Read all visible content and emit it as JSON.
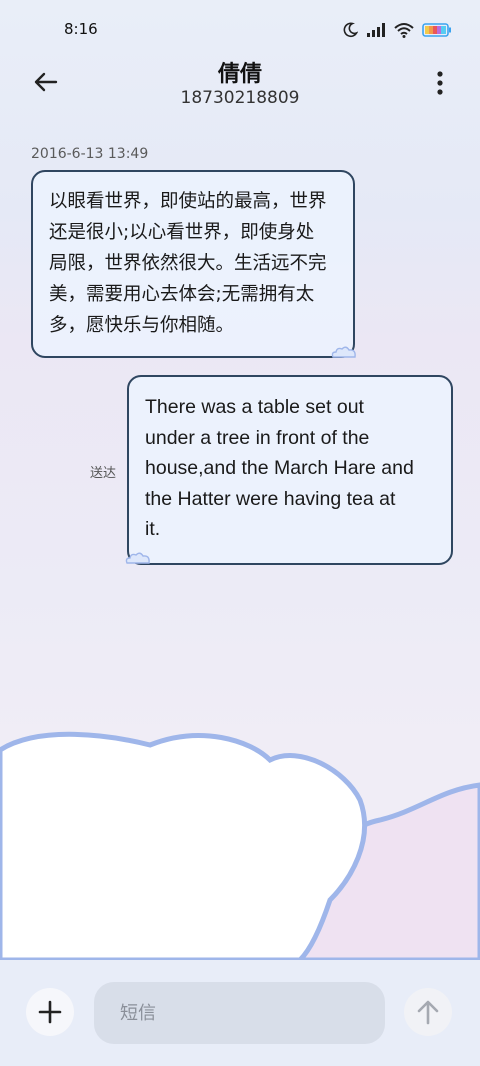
{
  "status_bar": {
    "time": "8:16",
    "icons": [
      "moon-icon",
      "signal-icon",
      "wifi-icon",
      "battery-icon"
    ]
  },
  "header": {
    "contact_name": "倩倩",
    "contact_number": "18730218809",
    "icons": [
      "back-arrow-icon",
      "more-vert-icon"
    ]
  },
  "conversation": {
    "timestamp": "2016-6-13 13:49",
    "messages": [
      {
        "direction": "incoming",
        "lines": [
          "以眼看世界，即使站的最高，世界",
          "还是很小;以心看世界，即使身处",
          "局限，世界依然很大。生活远不完",
          "美，需要用心去体会;无需拥有太",
          "多，愿快乐与你相随。"
        ]
      },
      {
        "direction": "outgoing",
        "status": "送达",
        "lines": [
          "There was a table set out",
          "under a tree in front of the",
          "house,and the March Hare and",
          "the Hatter were having tea at",
          "it."
        ]
      }
    ]
  },
  "composer": {
    "placeholder": "短信",
    "icons": [
      "plus-icon",
      "send-arrow-icon"
    ]
  },
  "colors": {
    "bubble_border": "#2f4660",
    "bubble_fill": "#ecf2fd",
    "cloud_outline": "#9fb6ea",
    "background_top": "#e9eef8"
  }
}
